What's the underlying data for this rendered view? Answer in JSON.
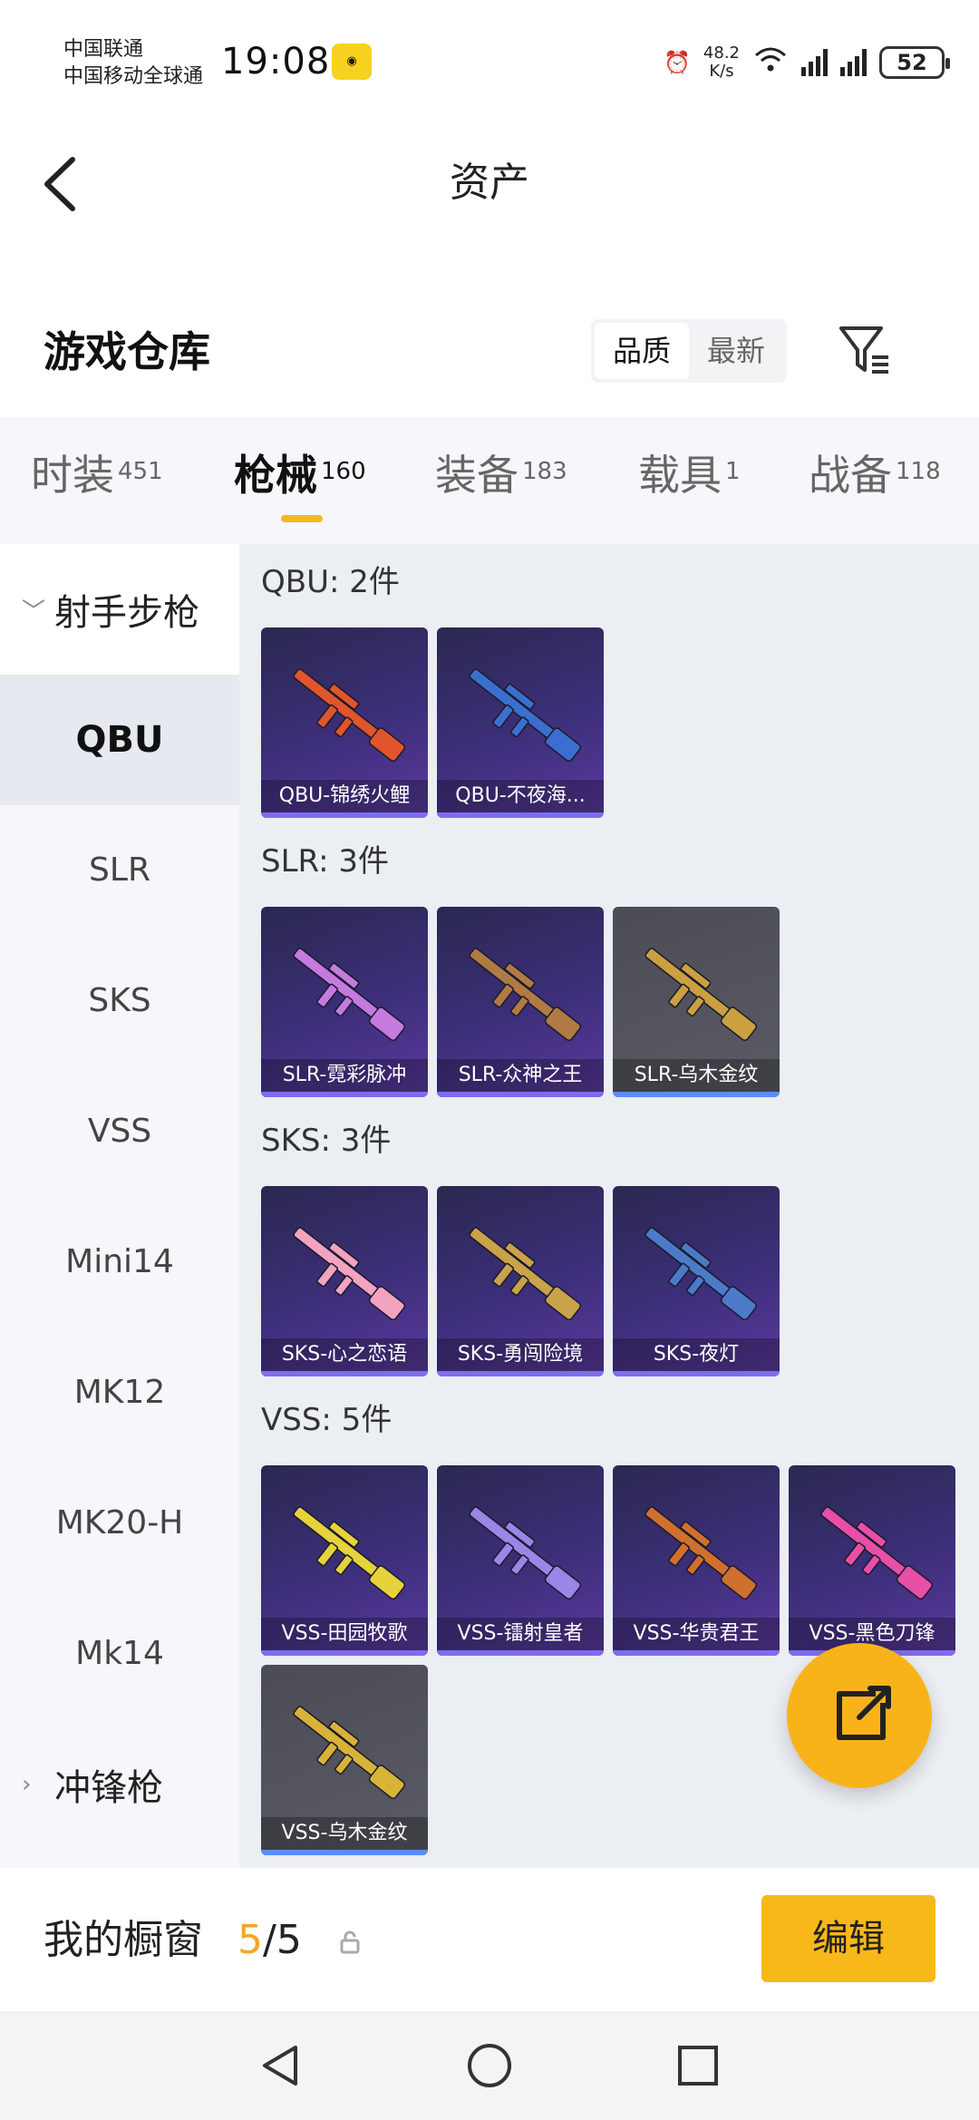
{
  "status_bar": {
    "carrier_1": "中国联通",
    "carrier_2": "中国移动全球通",
    "time": "19:08",
    "speed_value": "48.2",
    "speed_unit": "K/s",
    "battery": "52"
  },
  "header": {
    "title": "资产"
  },
  "warehouse": {
    "title": "游戏仓库",
    "sort_options": [
      "品质",
      "最新"
    ],
    "active_sort": "品质"
  },
  "tabs": [
    {
      "label": "时装",
      "count": "451"
    },
    {
      "label": "枪械",
      "count": "160"
    },
    {
      "label": "装备",
      "count": "183"
    },
    {
      "label": "载具",
      "count": "1"
    },
    {
      "label": "战备",
      "count": "118"
    }
  ],
  "active_tab": "枪械",
  "sidebar": {
    "group_open": "射手步枪",
    "items": [
      "QBU",
      "SLR",
      "SKS",
      "VSS",
      "Mini14",
      "MK12",
      "MK20-H",
      "Mk14"
    ],
    "active_item": "QBU",
    "group_closed": "冲锋枪"
  },
  "groups": [
    {
      "label": "QBU: 2件",
      "items": [
        {
          "name": "QBU-锦绣火鲤",
          "color": "#e0552b"
        },
        {
          "name": "QBU-不夜海...",
          "color": "#3a6fd0"
        }
      ]
    },
    {
      "label": "SLR: 3件",
      "items": [
        {
          "name": "SLR-霓彩脉冲",
          "color": "#c57adf"
        },
        {
          "name": "SLR-众神之王",
          "color": "#b07a45"
        },
        {
          "name": "SLR-乌木金纹",
          "color": "#caa040"
        }
      ]
    },
    {
      "label": "SKS: 3件",
      "items": [
        {
          "name": "SKS-心之恋语",
          "color": "#f2a3c0"
        },
        {
          "name": "SKS-勇闯险境",
          "color": "#c9a24a"
        },
        {
          "name": "SKS-夜灯",
          "color": "#4c7ac9"
        }
      ]
    },
    {
      "label": "VSS: 5件",
      "items": [
        {
          "name": "VSS-田园牧歌",
          "color": "#e6d23a"
        },
        {
          "name": "VSS-镭射皇者",
          "color": "#9b85e8"
        },
        {
          "name": "VSS-华贵君王",
          "color": "#d0702e"
        },
        {
          "name": "VSS-黑色刀锋",
          "color": "#e74fa8"
        },
        {
          "name": "VSS-乌木金纹",
          "color": "#d8b338"
        }
      ]
    }
  ],
  "showcase": {
    "label": "我的橱窗",
    "current": "5",
    "total": "/5",
    "edit_label": "编辑"
  },
  "icons": {
    "back": "back-arrow-icon",
    "filter": "filter-icon",
    "share": "share-icon",
    "lock": "lock-icon"
  },
  "accent_color": "#f8b81a"
}
